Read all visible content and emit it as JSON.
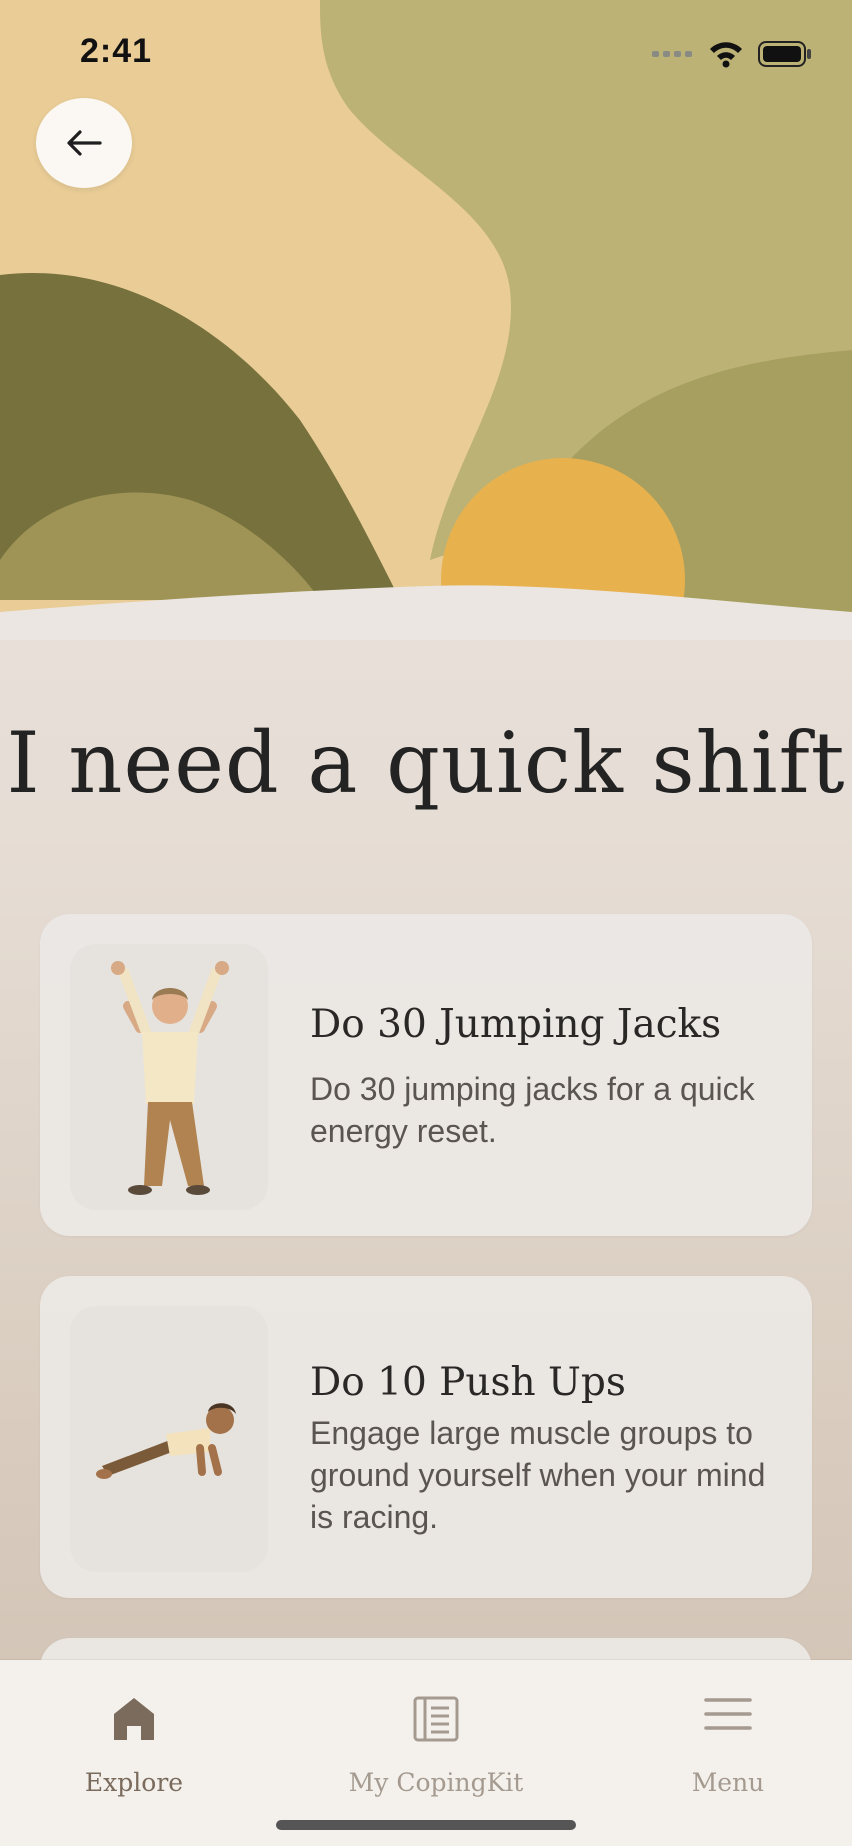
{
  "status_bar": {
    "time": "2:41"
  },
  "header": {
    "back_label": "Back"
  },
  "page": {
    "title": "I need a quick shift"
  },
  "cards": [
    {
      "title": "Do 30 Jumping Jacks",
      "description": "Do 30 jumping jacks for a quick energy reset."
    },
    {
      "title": "Do 10 Push Ups",
      "description": "Engage large muscle groups to ground yourself when your mind is racing."
    }
  ],
  "tabbar": {
    "items": [
      {
        "label": "Explore",
        "icon": "home-icon",
        "active": true
      },
      {
        "label": "My CopingKit",
        "icon": "book-icon",
        "active": false
      },
      {
        "label": "Menu",
        "icon": "menu-icon",
        "active": false
      }
    ]
  },
  "colors": {
    "hero_sand": "#e8cc96",
    "hero_olive": "#b6ad72",
    "hero_dark_olive": "#6f6a3a",
    "sun": "#e6b450",
    "accent_brown": "#7a6b5d"
  }
}
